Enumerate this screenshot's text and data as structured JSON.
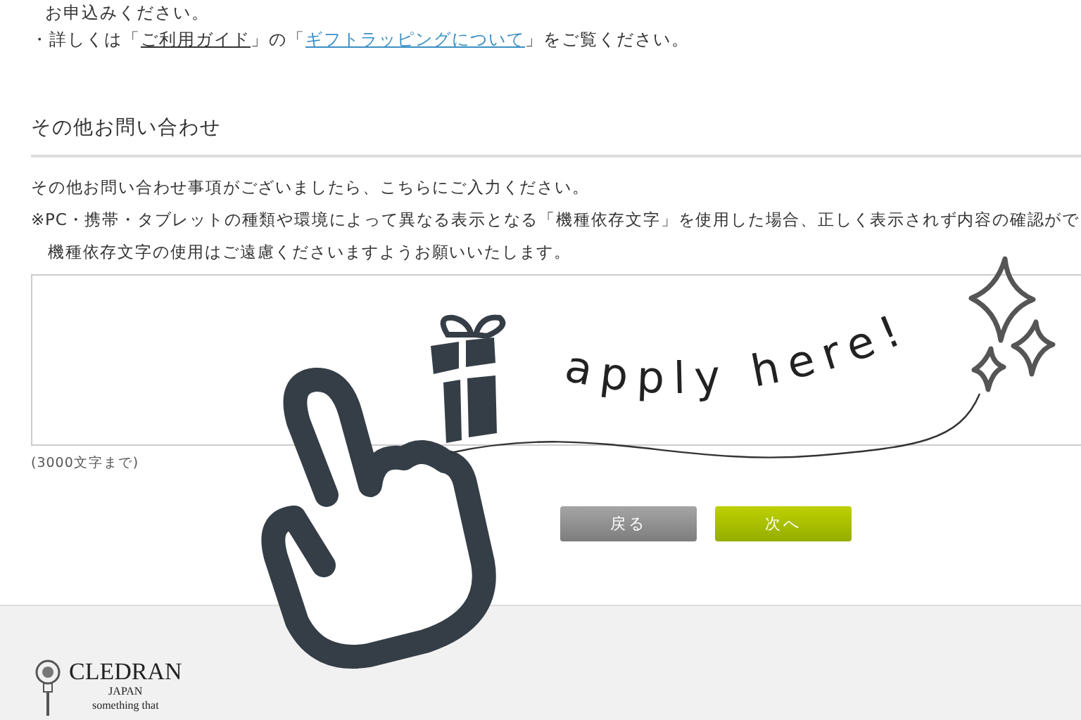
{
  "intro_lines": [
    "お申込みください。"
  ],
  "guide_line": [
    {
      "kind": "plain",
      "text": "・詳しくは「"
    },
    {
      "kind": "link",
      "text": "ご利用ガイド"
    },
    {
      "kind": "plain",
      "text": "」の「"
    },
    {
      "kind": "accent_link",
      "text": "ギフトラッピングについて"
    },
    {
      "kind": "plain",
      "text": "」をご覧ください。"
    }
  ],
  "section": {
    "heading": "その他お問い合わせ",
    "description": "その他お問い合わせ事項がございましたら、こちらにご入力ください。",
    "notes": [
      "※PC・携帯・タブレットの種類や環境によって異なる表示となる「機種依存文字」を使用した場合、正しく表示されず内容の確認がで",
      "機種依存文字の使用はご遠慮くださいますようお願いいたします。"
    ],
    "textarea_hint": "(3000文字まで)"
  },
  "buttons": [
    {
      "kind": "back",
      "label": "戻る"
    },
    {
      "kind": "next",
      "label": "次へ"
    }
  ],
  "overlay": {
    "caption": "apply here!"
  },
  "footer": {
    "brand": "CLEDRAN",
    "country": "JAPAN",
    "tagline": "something that"
  }
}
